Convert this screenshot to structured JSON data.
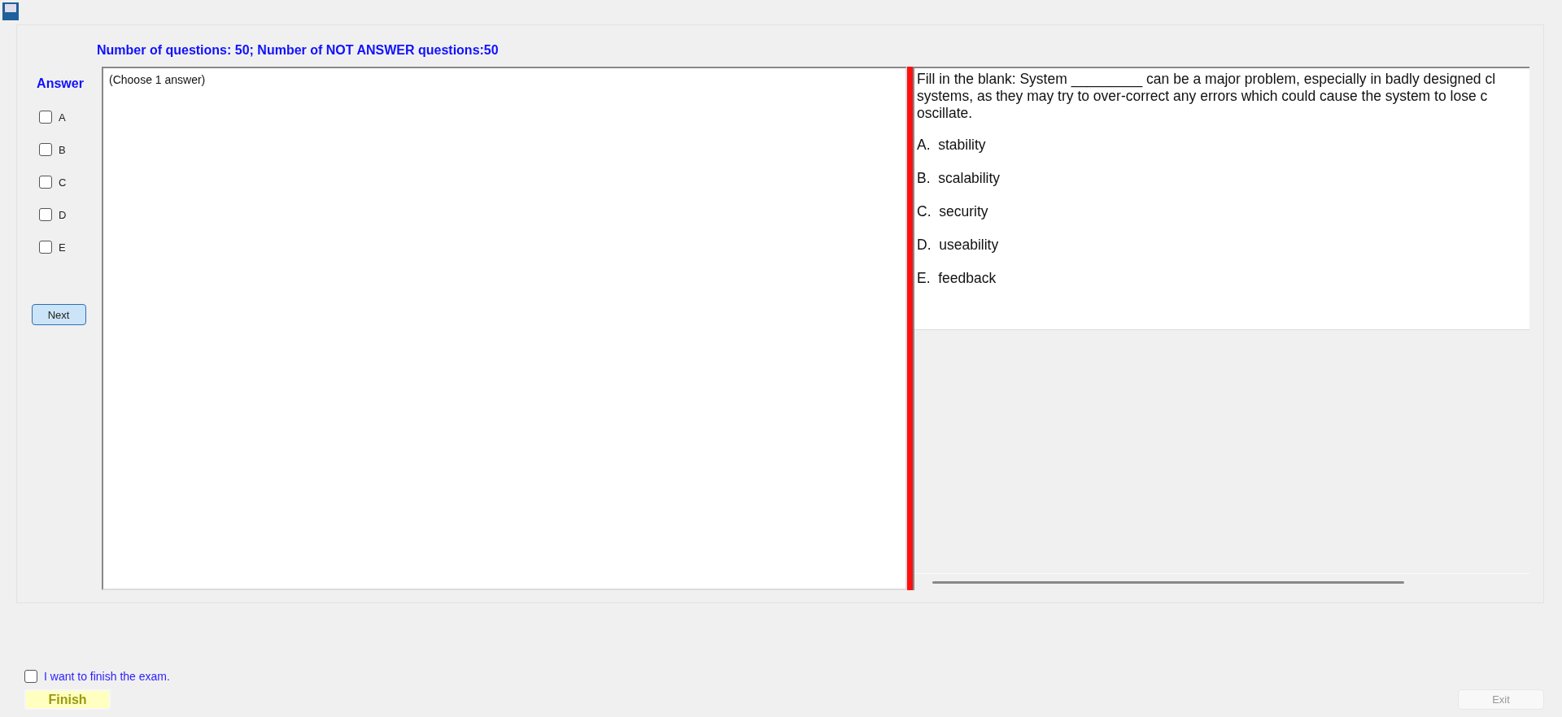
{
  "header": {
    "summary": "Number of questions: 50; Number of NOT ANSWER questions:50"
  },
  "answer_panel": {
    "title": "Answer",
    "choices": [
      {
        "label": "A",
        "checked": false
      },
      {
        "label": "B",
        "checked": false
      },
      {
        "label": "C",
        "checked": false
      },
      {
        "label": "D",
        "checked": false
      },
      {
        "label": "E",
        "checked": false
      }
    ],
    "next_button": "Next"
  },
  "answer_box": {
    "hint": "(Choose 1 answer)"
  },
  "question": {
    "lines": [
      "Fill in the blank: System _________ can be a major problem, especially in badly designed cl",
      "systems, as they may try to over-correct any errors which could cause the system to lose c",
      "oscillate."
    ],
    "options": [
      "A.  stability",
      "B.  scalability",
      "C.  security",
      "D.  useability",
      "E.  feedback"
    ]
  },
  "footer": {
    "confirm": {
      "label": "I want to finish the exam.",
      "checked": false
    },
    "finish_button": "Finish",
    "exit_button": "Exit"
  }
}
